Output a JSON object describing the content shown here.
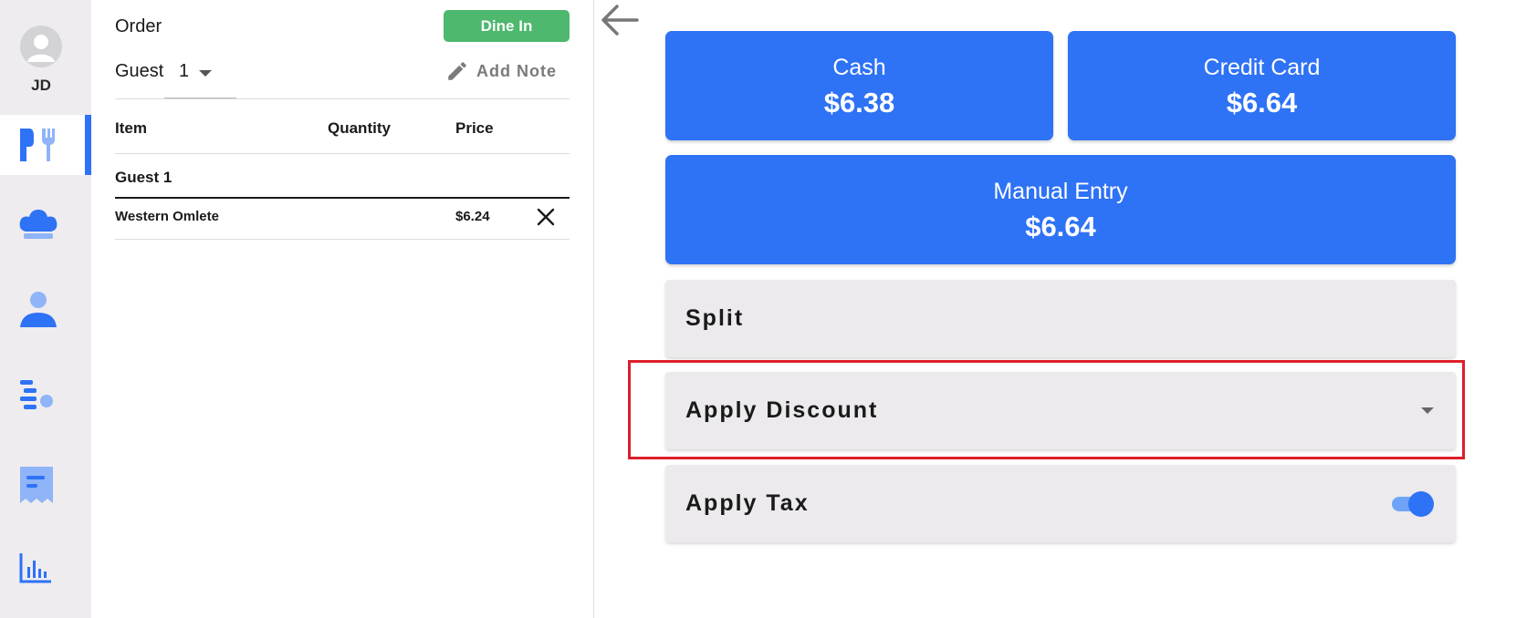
{
  "sidebar": {
    "user_initials": "JD",
    "nav": [
      {
        "icon": "utensils-icon",
        "active": true
      },
      {
        "icon": "chef-hat-icon",
        "active": false
      },
      {
        "icon": "person-icon",
        "active": false
      },
      {
        "icon": "list-icon",
        "active": false
      },
      {
        "icon": "receipt-icon",
        "active": false
      },
      {
        "icon": "bar-chart-icon",
        "active": false
      }
    ]
  },
  "order": {
    "title": "Order",
    "dine_in_label": "Dine In",
    "guest_label": "Guest",
    "guest_value": "1",
    "add_note_label": "Add Note",
    "columns": {
      "item": "Item",
      "quantity": "Quantity",
      "price": "Price"
    },
    "group_label": "Guest 1",
    "items": [
      {
        "name": "Western Omlete",
        "quantity": "",
        "price": "$6.24"
      }
    ]
  },
  "payment": {
    "cash": {
      "label": "Cash",
      "amount": "$6.38"
    },
    "credit_card": {
      "label": "Credit Card",
      "amount": "$6.64"
    },
    "manual_entry": {
      "label": "Manual Entry",
      "amount": "$6.64"
    },
    "split_label": "Split",
    "apply_discount_label": "Apply Discount",
    "apply_tax_label": "Apply Tax",
    "apply_tax_enabled": true
  },
  "colors": {
    "primary": "#2e72f5",
    "dine_in": "#4db86e",
    "highlight": "#dc1f2a",
    "sidebar_bg": "#eeecef",
    "option_bg": "#eceaed"
  }
}
